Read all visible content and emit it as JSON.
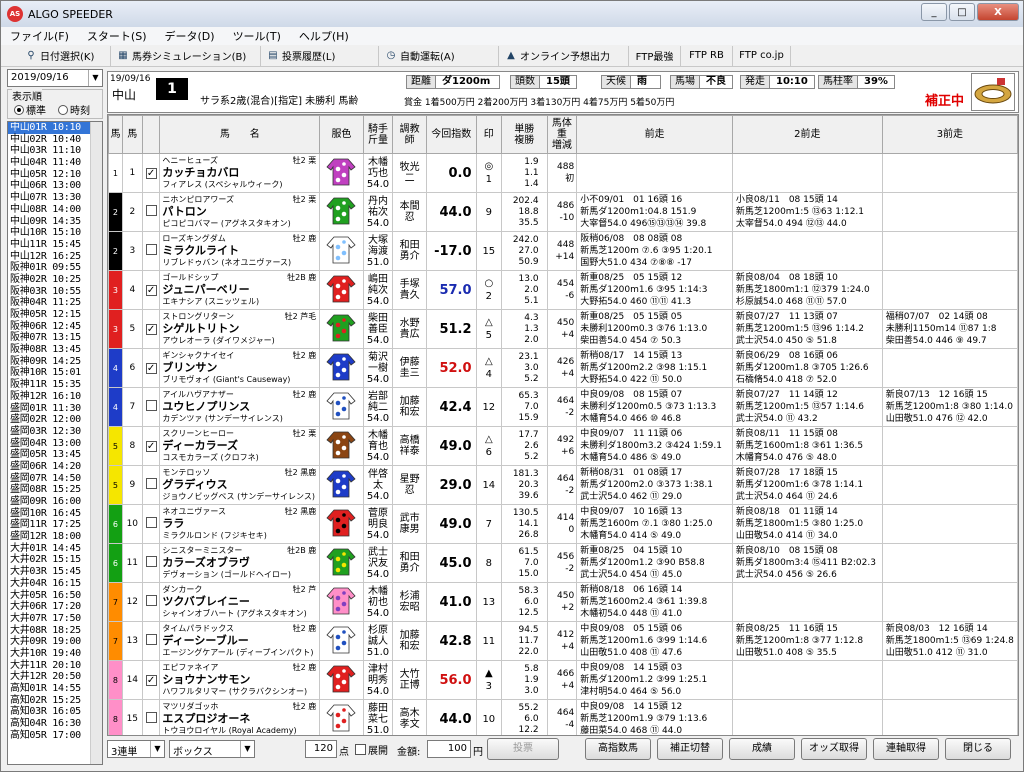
{
  "window": {
    "title": "ALGO SPEEDER",
    "icon": "AS",
    "min": "_",
    "max": "□",
    "close": "X"
  },
  "menu": [
    "ファイル(F)",
    "スタート(S)",
    "データ(D)",
    "ツール(T)",
    "ヘルプ(H)"
  ],
  "toolbar": [
    {
      "label": "日付選択(K)",
      "icon": "magnifier-icon"
    },
    {
      "label": "馬券シミュレーション(B)",
      "icon": "ticket-icon"
    },
    {
      "label": "投票履歴(L)",
      "icon": "document-icon"
    },
    {
      "label": "自動運転(A)",
      "icon": "clock-icon"
    },
    {
      "label": "オンライン予想出力",
      "icon": "upload-icon"
    },
    {
      "label": "FTP最強",
      "icon": ""
    },
    {
      "label": "FTP RB",
      "icon": ""
    },
    {
      "label": "FTP co.jp",
      "icon": ""
    }
  ],
  "left": {
    "date": "2019/09/16",
    "display_order_label": "表示順",
    "radio_standard": "標準",
    "radio_time": "時刻",
    "races": [
      "中山01R 10:10",
      "中山02R 10:40",
      "中山03R 11:10",
      "中山04R 11:40",
      "中山05R 12:10",
      "中山06R 13:00",
      "中山07R 13:30",
      "中山08R 14:00",
      "中山09R 14:35",
      "中山10R 15:10",
      "中山11R 15:45",
      "中山12R 16:25",
      "阪神01R 09:55",
      "阪神02R 10:25",
      "阪神03R 10:55",
      "阪神04R 11:25",
      "阪神05R 12:15",
      "阪神06R 12:45",
      "阪神07R 13:15",
      "阪神08R 13:45",
      "阪神09R 14:25",
      "阪神10R 15:01",
      "阪神11R 15:35",
      "阪神12R 16:10",
      "盛岡01R 11:30",
      "盛岡02R 12:00",
      "盛岡03R 12:30",
      "盛岡04R 13:00",
      "盛岡05R 13:45",
      "盛岡06R 14:20",
      "盛岡07R 14:50",
      "盛岡08R 15:25",
      "盛岡09R 16:00",
      "盛岡10R 16:45",
      "盛岡11R 17:25",
      "盛岡12R 18:00",
      "大井01R 14:45",
      "大井02R 15:15",
      "大井03R 15:45",
      "大井04R 16:15",
      "大井05R 16:50",
      "大井06R 17:20",
      "大井07R 17:50",
      "大井08R 18:25",
      "大井09R 19:00",
      "大井10R 19:40",
      "大井11R 20:10",
      "大井12R 20:50",
      "高知01R 14:55",
      "高知02R 15:25",
      "高知03R 16:05",
      "高知04R 16:30",
      "高知05R 17:00"
    ]
  },
  "header": {
    "date": "19/09/16",
    "place": "中山",
    "race_no": "1",
    "race_name": "サラ系2歳(混合)[指定] 未勝利 馬齢",
    "distance_label": "距離",
    "distance": "ダ1200m",
    "heads_label": "頭数",
    "heads": "15頭",
    "weather_label": "天候",
    "weather": "雨",
    "baba_label": "馬場",
    "baba": "不良",
    "post_label": "発走",
    "post": "10:10",
    "rate_label": "馬柱率",
    "rate": "39%",
    "prize": "賞金  1着500万円   2着200万円   3着130万円   4着75万円   5着50万円",
    "hosei": "補正中"
  },
  "columns": {
    "waku": "馬",
    "umaban": "馬",
    "name": "馬　　名",
    "silk": "服色",
    "jockey": "騎手\n斤量",
    "trainer": "調教\n師",
    "score": "今回指数",
    "mark": "印",
    "odds": "単勝\n複勝",
    "wt": "馬体重\n増減",
    "p1": "前走",
    "p2": "2前走",
    "p3": "3前走"
  },
  "horses": [
    {
      "waku": "1",
      "num": "1",
      "chk": "✓",
      "sire": "ヘニーヒューズ",
      "name": "カッチョカバロ",
      "dam": "フィアレス (スペシャルウィーク)",
      "sexage": "牡2 栗",
      "jockey": [
        "木幡",
        "巧也",
        "54.0"
      ],
      "trainer": [
        "牧光",
        "二"
      ],
      "score": "0.0",
      "sc": "",
      "mark": [
        "◎",
        "1"
      ],
      "odds": [
        "1.9",
        "1.1",
        "1.4"
      ],
      "wt": [
        "488",
        "初"
      ],
      "p1": [
        "",
        "",
        ""
      ],
      "p2": [
        "",
        "",
        ""
      ],
      "p3": [
        "",
        "",
        ""
      ]
    },
    {
      "waku": "2",
      "num": "2",
      "chk": "",
      "sire": "ニホンピロアワーズ",
      "name": "パトロン",
      "dam": "ピコピコバマー (アグネスタキオン)",
      "sexage": "牡2 栗",
      "jockey": [
        "丹内",
        "祐次",
        "54.0"
      ],
      "trainer": [
        "本間",
        "忍"
      ],
      "score": "44.0",
      "sc": "",
      "mark": [
        "",
        "9"
      ],
      "odds": [
        "202.4",
        "18.8",
        "35.5"
      ],
      "wt": [
        "486",
        "-10"
      ],
      "p1": [
        "小不09/01　01 16頭 16",
        "新馬ダ1200m1:04.8 151.9",
        "大宰督54.0 496⑮⑬⑬⑭ 39.8"
      ],
      "p2": [
        "小良08/11　08 15頭 14",
        "新馬芝1200m1:5 ⑬63 1:12.1",
        "太宰督54.0 494 ⑫⑬ 44.0"
      ],
      "p3": [
        "",
        "",
        ""
      ]
    },
    {
      "waku": "2",
      "num": "3",
      "chk": "",
      "sire": "ローズキングダム",
      "name": "ミラクルライト",
      "dam": "リブレドゥバン (ネオユニヴァース)",
      "sexage": "牡2 鹿",
      "jockey": [
        "大塚",
        "海渡",
        "51.0"
      ],
      "trainer": [
        "和田",
        "勇介"
      ],
      "score": "-17.0",
      "sc": "",
      "mark": [
        "",
        "15"
      ],
      "odds": [
        "242.0",
        "27.0",
        "50.9"
      ],
      "wt": [
        "448",
        "+14"
      ],
      "p1": [
        "阪稍06/08　08 08頭 08",
        "新馬芝1200m ⑦.6 ③95 1:20.1",
        "国野大51.0 434 ⑦⑧⑧ -17"
      ],
      "p2": [
        "",
        "",
        ""
      ],
      "p3": [
        "",
        "",
        ""
      ]
    },
    {
      "waku": "3",
      "num": "4",
      "chk": "✓",
      "sire": "ゴールドシップ",
      "name": "ジュニパーベリー",
      "dam": "エキナシア (スニッツェル)",
      "sexage": "牡2B 鹿",
      "jockey": [
        "嶋田",
        "純次",
        "54.0"
      ],
      "trainer": [
        "手塚",
        "貴久"
      ],
      "score": "57.0",
      "sc": "blue",
      "mark": [
        "○",
        "2"
      ],
      "odds": [
        "13.0",
        "2.0",
        "5.1"
      ],
      "wt": [
        "454",
        "-6"
      ],
      "p1": [
        "新重08/25　05 15頭 12",
        "新馬ダ1200m1.6 ③95 1:14:3",
        "大野拓54.0 460 ⑪⑪ 41.3"
      ],
      "p2": [
        "新良08/04　08 18頭 10",
        "新馬芝1800m1:1 ⑫379 1:24.0",
        "杉原誠54.0 468 ⑪⑪ 57.0"
      ],
      "p3": [
        "",
        "",
        ""
      ]
    },
    {
      "waku": "3",
      "num": "5",
      "chk": "✓",
      "sire": "ストロングリターン",
      "name": "シゲルトリトン",
      "dam": "アウレオーラ (ダイワメジャー)",
      "sexage": "牡2 芦毛",
      "jockey": [
        "柴田",
        "善臣",
        "54.0"
      ],
      "trainer": [
        "水野",
        "貴広"
      ],
      "score": "51.2",
      "sc": "",
      "mark": [
        "△",
        "5"
      ],
      "odds": [
        "4.3",
        "1.3",
        "2.0"
      ],
      "wt": [
        "450",
        "+4"
      ],
      "p1": [
        "新重08/25　05 15頭 05",
        "未勝利1200m0.3 ③76 1:13.0",
        "柴田善54.0 454 ⑦ 50.3"
      ],
      "p2": [
        "新良07/27　11 13頭 07",
        "新馬芝1200m1:5 ⑬96 1:14.2",
        "武士沢54.0 450 ⑤ 51.8"
      ],
      "p3": [
        "福稍07/07　02 14頭 08",
        "未勝利1150m14 ⑪87 1:8",
        "柴田善54.0 446 ⑨ 49.7"
      ]
    },
    {
      "waku": "4",
      "num": "6",
      "chk": "✓",
      "sire": "ギンシャクナイセイ",
      "name": "ブリンサン",
      "dam": "ブリモヴォイ (Giant's Causeway)",
      "sexage": "牡2 鹿",
      "jockey": [
        "菊沢",
        "一樹",
        "54.0"
      ],
      "trainer": [
        "伊藤",
        "圭三"
      ],
      "score": "52.0",
      "sc": "red",
      "mark": [
        "△",
        "4"
      ],
      "odds": [
        "23.1",
        "3.0",
        "5.2"
      ],
      "wt": [
        "426",
        "+4"
      ],
      "p1": [
        "新稍08/17　14 15頭 13",
        "新馬ダ1200m2.2 ③98 1:15.1",
        "大野拓54.0 422 ⑪ 50.0"
      ],
      "p2": [
        "新良06/29　08 16頭 06",
        "新馬ダ1200m1.8 ③705 1:26.6",
        "石橋脩54.0 418 ⑦ 52.0"
      ],
      "p3": [
        "",
        "",
        ""
      ]
    },
    {
      "waku": "4",
      "num": "7",
      "chk": "",
      "sire": "アイルハヴアナザー",
      "name": "ユウヒノプリンス",
      "dam": "カデンツァ (サンデーサイレンス)",
      "sexage": "牡2 鹿",
      "jockey": [
        "岩部",
        "純二",
        "54.0"
      ],
      "trainer": [
        "加藤",
        "和宏"
      ],
      "score": "42.4",
      "sc": "",
      "mark": [
        "",
        "12"
      ],
      "odds": [
        "65.3",
        "7.0",
        "15.9"
      ],
      "wt": [
        "464",
        "-2"
      ],
      "p1": [
        "中良09/08　08 15頭 07",
        "未勝利ダ1200m0.5 ③73 1:13.3",
        "木幡育54.0 466 ⑩ 46.8"
      ],
      "p2": [
        "新良07/27　11 14頭 12",
        "新馬芝1200m1:5 ⑬57 1:14.6",
        "武士沢54.0 ⑪ 43.2"
      ],
      "p3": [
        "新良07/13　12 16頭 15",
        "新馬芝1200m1:8 ③80 1:14.0",
        "山田敬51.0 476 ⑫ 42.0"
      ]
    },
    {
      "waku": "5",
      "num": "8",
      "chk": "✓",
      "sire": "スクリーンヒーロー",
      "name": "ディーカラーズ",
      "dam": "コスモカラーズ (クロフネ)",
      "sexage": "牡2 栗",
      "jockey": [
        "木幡",
        "育也",
        "54.0"
      ],
      "trainer": [
        "高橋",
        "祥泰"
      ],
      "score": "49.0",
      "sc": "",
      "mark": [
        "△",
        "6"
      ],
      "odds": [
        "17.7",
        "2.6",
        "5.2"
      ],
      "wt": [
        "492",
        "+6"
      ],
      "p1": [
        "中良09/07　11 11頭 06",
        "未勝利ダ1800m3.2 ③424 1:59.1",
        "木幡育54.0 486 ⑤ 49.0"
      ],
      "p2": [
        "新良08/11　11 15頭 08",
        "新馬芝1600m1:8 ③61 1:36.5",
        "木幡育54.0 476 ⑤ 48.0"
      ],
      "p3": [
        "",
        "",
        ""
      ]
    },
    {
      "waku": "5",
      "num": "9",
      "chk": "",
      "sire": "モンテロッソ",
      "name": "グラディウス",
      "dam": "ジョウノビッグベス (サンデーサイレンス)",
      "sexage": "牡2 黒鹿",
      "jockey": [
        "伴啓",
        "太",
        "54.0"
      ],
      "trainer": [
        "星野",
        "忍"
      ],
      "score": "29.0",
      "sc": "",
      "mark": [
        "",
        "14"
      ],
      "odds": [
        "181.3",
        "20.3",
        "39.6"
      ],
      "wt": [
        "464",
        "-2"
      ],
      "p1": [
        "新稍08/31　01 08頭 17",
        "新馬ダ1200m2.0 ③373 1:38.1",
        "武士沢54.0 462 ⑪ 29.0"
      ],
      "p2": [
        "新良07/28　17 18頭 15",
        "新馬ダ1200m1:6 ③78 1:14.1",
        "武士沢54.0 464 ⑪ 24.6"
      ],
      "p3": [
        "",
        "",
        ""
      ]
    },
    {
      "waku": "6",
      "num": "10",
      "chk": "",
      "sire": "ネオユニヴァース",
      "name": "ララ",
      "dam": "ミラクルロンド (フジキセキ)",
      "sexage": "牡2 黒鹿",
      "jockey": [
        "菅原",
        "明良",
        "54.0"
      ],
      "trainer": [
        "武市",
        "康男"
      ],
      "score": "49.0",
      "sc": "",
      "mark": [
        "",
        "7"
      ],
      "odds": [
        "130.5",
        "14.1",
        "26.8"
      ],
      "wt": [
        "414",
        "0"
      ],
      "p1": [
        "中良09/07　10 16頭 13",
        "新馬芝1600m ⑦.1 ③80 1:25.0",
        "木幡育54.0 414 ⑤ 49.0"
      ],
      "p2": [
        "新良08/18　01 11頭 14",
        "新馬芝1800m1:5 ③80 1:25.0",
        "山田敬54.0 414 ⑪ 34.0"
      ],
      "p3": [
        "",
        "",
        ""
      ]
    },
    {
      "waku": "6",
      "num": "11",
      "chk": "",
      "sire": "シニスターミニスター",
      "name": "カラーズオブラヴ",
      "dam": "デヴォーション (ゴールドヘイロー)",
      "sexage": "牡2B 鹿",
      "jockey": [
        "武士",
        "沢友",
        "54.0"
      ],
      "trainer": [
        "和田",
        "勇介"
      ],
      "score": "45.0",
      "sc": "",
      "mark": [
        "",
        "8"
      ],
      "odds": [
        "61.5",
        "7.0",
        "15.0"
      ],
      "wt": [
        "456",
        "-2"
      ],
      "p1": [
        "新重08/25　04 15頭 10",
        "新馬ダ1200m1.2 ③90 B58.8",
        "武士沢54.0 454 ⑪ 45.0"
      ],
      "p2": [
        "新良08/10　08 15頭 08",
        "新馬ダ1800m3:4 ⑮411 B2:02.3",
        "武士沢54.0 456 ⑤ 26.6"
      ],
      "p3": [
        "",
        "",
        ""
      ]
    },
    {
      "waku": "7",
      "num": "12",
      "chk": "",
      "sire": "ダンカーク",
      "name": "ツクバブレイニー",
      "dam": "シャインオブハート (アグネスタキオン)",
      "sexage": "牡2 芦",
      "jockey": [
        "木幡",
        "初也",
        "54.0"
      ],
      "trainer": [
        "杉浦",
        "宏昭"
      ],
      "score": "41.0",
      "sc": "",
      "mark": [
        "",
        "13"
      ],
      "odds": [
        "58.3",
        "6.0",
        "12.5"
      ],
      "wt": [
        "450",
        "+2"
      ],
      "p1": [
        "新稍08/18　06 16頭 14",
        "新馬芝1600m2.4 ③61 1:39.8",
        "木幡初54.0 448 ⑪ 41.0"
      ],
      "p2": [
        "",
        "",
        ""
      ],
      "p3": [
        "",
        "",
        ""
      ]
    },
    {
      "waku": "7",
      "num": "13",
      "chk": "",
      "sire": "タイムパラドックス",
      "name": "ディーシーブルー",
      "dam": "エージングケアール (ディープインパクト)",
      "sexage": "牡2 鹿",
      "jockey": [
        "杉原",
        "誠人",
        "51.0"
      ],
      "trainer": [
        "加藤",
        "和宏"
      ],
      "score": "42.8",
      "sc": "",
      "mark": [
        "",
        "11"
      ],
      "odds": [
        "94.5",
        "11.7",
        "22.0"
      ],
      "wt": [
        "412",
        "+4"
      ],
      "p1": [
        "中良09/08　05 15頭 06",
        "新馬芝1200m1.6 ③99 1:14.6",
        "山田敬51.0 408 ⑪ 47.6"
      ],
      "p2": [
        "新良08/25　11 16頭 15",
        "新馬芝1200m1:8 ③77 1:12.8",
        "山田敬51.0 408 ⑤ 35.5"
      ],
      "p3": [
        "新良08/03　12 16頭 14",
        "新馬芝1800m1:5 ⑬69 1:24.8",
        "山田敬51.0 412 ⑪ 31.0"
      ]
    },
    {
      "waku": "8",
      "num": "14",
      "chk": "✓",
      "sire": "エピファネイア",
      "name": "ショウナンサモン",
      "dam": "ハワフルタリマー (サクラバクシンオー)",
      "sexage": "牡2 鹿",
      "jockey": [
        "津村",
        "明秀",
        "54.0"
      ],
      "trainer": [
        "大竹",
        "正博"
      ],
      "score": "56.0",
      "sc": "red",
      "mark": [
        "▲",
        "3"
      ],
      "odds": [
        "5.8",
        "1.9",
        "3.0"
      ],
      "wt": [
        "466",
        "+4"
      ],
      "p1": [
        "中良09/08　14 15頭 03",
        "新馬ダ1200m1.2 ③99 1:25.1",
        "津村明54.0 464 ⑤ 56.0"
      ],
      "p2": [
        "",
        "",
        ""
      ],
      "p3": [
        "",
        "",
        ""
      ]
    },
    {
      "waku": "8",
      "num": "15",
      "chk": "",
      "sire": "マツリダゴッホ",
      "name": "エスプロジオーネ",
      "dam": "トウヨウロイヤル (Royal Academy)",
      "sexage": "牡2 鹿",
      "jockey": [
        "藤田",
        "菜七",
        "51.0"
      ],
      "trainer": [
        "高木",
        "孝文"
      ],
      "score": "44.0",
      "sc": "",
      "mark": [
        "",
        "10"
      ],
      "odds": [
        "55.2",
        "6.0",
        "12.2"
      ],
      "wt": [
        "464",
        "-4"
      ],
      "p1": [
        "中良09/08　14 15頭 12",
        "新馬芝1200m1.9 ③79 1:13.6",
        "藤田菜54.0 468 ⑪ 44.0"
      ],
      "p2": [
        "",
        "",
        ""
      ],
      "p3": [
        "",
        "",
        ""
      ]
    }
  ],
  "waku_colors": {
    "1": "#ffffff",
    "2": "#000000",
    "3": "#e02020",
    "4": "#1e3cc8",
    "5": "#f5e600",
    "6": "#13a013",
    "7": "#ff8c00",
    "8": "#ff8fc8"
  },
  "silk_colors": [
    [
      "#c040c0",
      "#ffffff"
    ],
    [
      "#20a020",
      "#ffffff"
    ],
    [
      "#ffffff",
      "#80c0ff"
    ],
    [
      "#e02020",
      "#ffffff"
    ],
    [
      "#20a020",
      "#e02020"
    ],
    [
      "#1e3cc8",
      "#ffffff"
    ],
    [
      "#ffffff",
      "#2050c0"
    ],
    [
      "#8b4513",
      "#ffffff"
    ],
    [
      "#1e3cc8",
      "#ffffff"
    ],
    [
      "#e02020",
      "#000000"
    ],
    [
      "#20a020",
      "#f5e600"
    ],
    [
      "#ff8fc8",
      "#8040c0"
    ],
    [
      "#ffffff",
      "#2050c0"
    ],
    [
      "#e02020",
      "#ffffff"
    ],
    [
      "#ffffff",
      "#e02020"
    ]
  ],
  "bottom": {
    "bet_type": "3連単",
    "bet_mode": "ボックス",
    "points": "120",
    "points_label": "点",
    "expand": "展開",
    "amount_label": "金額:",
    "amount": "100",
    "yen": "円",
    "vote": "投票",
    "buttons": [
      "高指数馬",
      "補正切替",
      "成績",
      "オッズ取得",
      "連軸取得",
      "閉じる"
    ]
  }
}
